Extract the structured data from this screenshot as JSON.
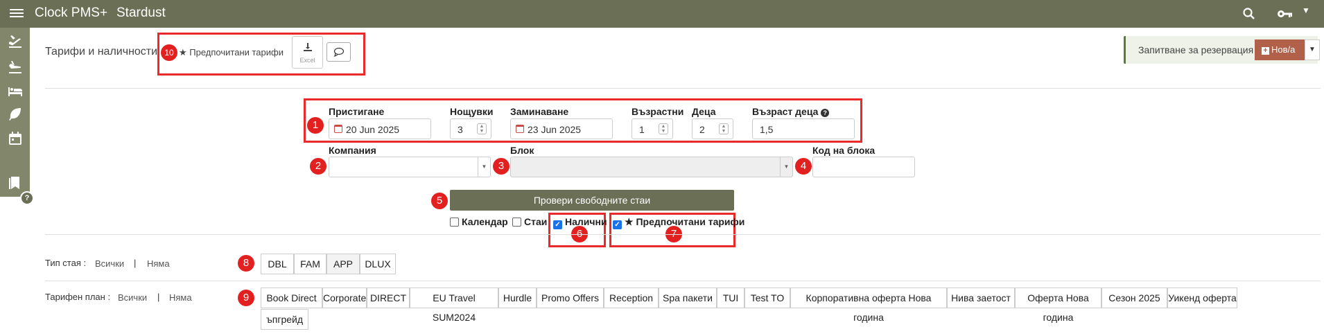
{
  "app": {
    "brand": "Clock PMS+",
    "hotel": "Stardust"
  },
  "page": {
    "title": "Тарифи и наличности",
    "preferred_link": "Предпочитани тарифи",
    "excel_label": "Excel"
  },
  "request": {
    "label": "Запитване за резервация :",
    "new_label": "Нов/а"
  },
  "form": {
    "arrival": {
      "label": "Пристигане",
      "value": "20 Jun 2025"
    },
    "nights": {
      "label": "Нощувки",
      "value": "3"
    },
    "departure": {
      "label": "Заминаване",
      "value": "23 Jun 2025"
    },
    "adults": {
      "label": "Възрастни",
      "value": "1"
    },
    "children": {
      "label": "Деца",
      "value": "2"
    },
    "child_ages": {
      "label": "Възраст деца",
      "value": "1,5"
    },
    "company": {
      "label": "Компания",
      "value": ""
    },
    "block": {
      "label": "Блок",
      "value": ""
    },
    "block_code": {
      "label": "Код на блока",
      "value": ""
    },
    "check_button": "Провери свободните стаи",
    "checkboxes": {
      "calendar": "Календар",
      "rooms": "Стаи",
      "available": "Налични",
      "preferred": "Предпочитани тарифи"
    }
  },
  "room_type": {
    "label": "Тип стая :",
    "all": "Всички",
    "none": "Няма",
    "separator": "|",
    "items": [
      "DBL",
      "FAM",
      "APP",
      "DLUX"
    ]
  },
  "rate_plan": {
    "label": "Тарифен план :",
    "all": "Всички",
    "none": "Няма",
    "separator": "|",
    "items": [
      "Book Direct",
      "Corporate",
      "DIRECT",
      "EU Travel SUM2024",
      "Hurdle",
      "Promo Offers",
      "Reception",
      "Spa пакети",
      "TUI",
      "Test TO",
      "Корпоративна оферта Нова година",
      "Нива заетост",
      "Оферта Нова година",
      "Сезон 2025",
      "Уикенд оферта",
      "ъпгрейд"
    ]
  },
  "annotations": [
    "1",
    "2",
    "3",
    "4",
    "5",
    "6",
    "7",
    "8",
    "9",
    "10"
  ],
  "colors": {
    "topbar": "#6b6f55",
    "sidebar": "#82866b",
    "accent_new": "#b1614a",
    "annotation": "#ea2a2a"
  }
}
